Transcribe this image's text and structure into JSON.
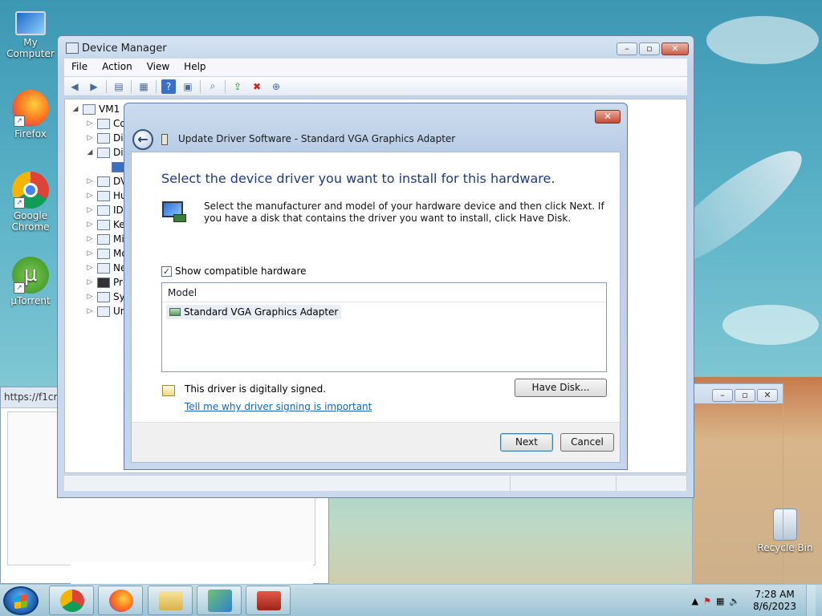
{
  "desktop": {
    "icons": [
      {
        "label": "My Computer"
      },
      {
        "label": "Firefox"
      },
      {
        "label": "Google Chrome"
      },
      {
        "label": "µTorrent"
      },
      {
        "label": "Recycle Bin"
      }
    ]
  },
  "background_browser": {
    "url_fragment": "https://f1cr.c"
  },
  "device_manager": {
    "title": "Device Manager",
    "menu": [
      "File",
      "Action",
      "View",
      "Help"
    ],
    "tree": {
      "root": "VM1",
      "children": [
        "Co",
        "Di",
        "Di",
        "",
        "DV",
        "Hu",
        "ID",
        "Ke",
        "Mi",
        "Mo",
        "Ne",
        "Pr",
        "Sy",
        "Ur"
      ]
    }
  },
  "update_dialog": {
    "title": "Update Driver Software - Standard VGA Graphics Adapter",
    "heading": "Select the device driver you want to install for this hardware.",
    "instruction": "Select the manufacturer and model of your hardware device and then click Next. If you have a disk that contains the driver you want to install, click Have Disk.",
    "show_compatible_label": "Show compatible hardware",
    "show_compatible_checked": true,
    "model_column": "Model",
    "models": [
      "Standard VGA Graphics Adapter"
    ],
    "signed_text": "This driver is digitally signed.",
    "signing_link": "Tell me why driver signing is important",
    "have_disk": "Have Disk...",
    "next": "Next",
    "cancel": "Cancel"
  },
  "taskbar": {
    "time": "7:28 AM",
    "date": "8/6/2023"
  }
}
